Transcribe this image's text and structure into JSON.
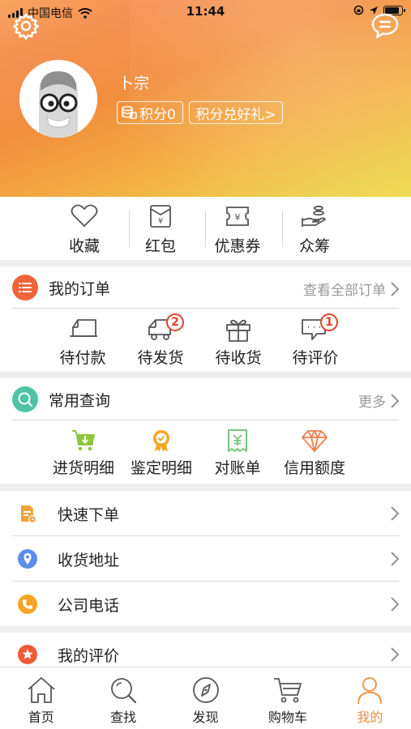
{
  "status_bar": {
    "carrier": "中国电信",
    "time": "11:44"
  },
  "profile": {
    "username": "卜宗",
    "points_label": "积分0",
    "redeem_label": "积分兑好礼>"
  },
  "quick_actions": [
    {
      "label": "收藏",
      "icon": "heart-icon"
    },
    {
      "label": "红包",
      "icon": "red-envelope-icon"
    },
    {
      "label": "优惠券",
      "icon": "coupon-icon"
    },
    {
      "label": "众筹",
      "icon": "crowdfunding-icon"
    }
  ],
  "orders": {
    "title": "我的订单",
    "more": "查看全部订单",
    "items": [
      {
        "label": "待付款",
        "icon": "truck-icon",
        "badge": ""
      },
      {
        "label": "待发货",
        "icon": "truck-icon",
        "badge": "2"
      },
      {
        "label": "待收货",
        "icon": "gift-icon",
        "badge": ""
      },
      {
        "label": "待评价",
        "icon": "comment-icon",
        "badge": "1"
      }
    ]
  },
  "queries": {
    "title": "常用查询",
    "more": "更多",
    "items": [
      {
        "label": "进货明细",
        "icon": "cart-download-icon"
      },
      {
        "label": "鉴定明细",
        "icon": "award-icon"
      },
      {
        "label": "对账单",
        "icon": "receipt-icon"
      },
      {
        "label": "信用额度",
        "icon": "diamond-icon"
      }
    ]
  },
  "menu": [
    {
      "label": "快速下单",
      "icon": "clipboard-icon"
    },
    {
      "label": "收货地址",
      "icon": "location-pin-icon"
    },
    {
      "label": "公司电话",
      "icon": "phone-icon"
    }
  ],
  "menu2": [
    {
      "label": "我的评价",
      "icon": "star-icon"
    }
  ],
  "tabs": [
    {
      "label": "首页",
      "icon": "home-icon"
    },
    {
      "label": "查找",
      "icon": "search-icon"
    },
    {
      "label": "发现",
      "icon": "compass-icon"
    },
    {
      "label": "购物车",
      "icon": "cart-icon"
    },
    {
      "label": "我的",
      "icon": "user-icon",
      "active": true
    }
  ],
  "colors": {
    "accent": "#f28e3c",
    "orders_icon": "#f0643a",
    "queries_icon": "#4fc4a5",
    "badge": "#e2412f"
  }
}
